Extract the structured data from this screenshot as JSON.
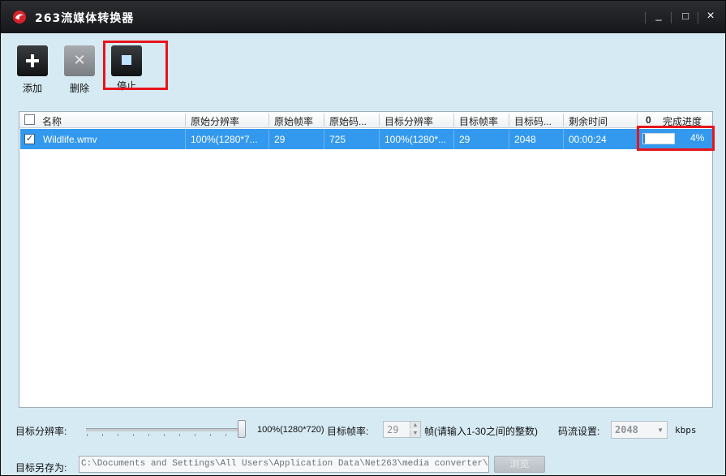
{
  "window": {
    "title": "263流媒体转换器",
    "controls": {
      "minimize": "_",
      "maximize": "□",
      "close": "×"
    }
  },
  "toolbar": {
    "add_label": "添加",
    "delete_label": "删除",
    "stop_label": "停止"
  },
  "table": {
    "headers": {
      "name": "名称",
      "src_resolution": "原始分辨率",
      "src_fps": "原始帧率",
      "src_bitrate": "原始码...",
      "dst_resolution": "目标分辨率",
      "dst_fps": "目标帧率",
      "dst_bitrate": "目标码...",
      "remaining": "剩余时间",
      "attach": "0",
      "progress": "完成进度"
    },
    "rows": [
      {
        "checked": true,
        "name": "Wildlife.wmv",
        "src_resolution": "100%(1280*7...",
        "src_fps": "29",
        "src_bitrate": "725",
        "dst_resolution": "100%(1280*...",
        "dst_fps": "29",
        "dst_bitrate": "2048",
        "remaining": "00:00:24",
        "progress_value": 0.04,
        "progress_text": "4%"
      }
    ]
  },
  "settings": {
    "resolution_label": "目标分辨率:",
    "resolution_value": "100%(1280*720)",
    "fps_label": "目标帧率:",
    "fps_value": "29",
    "fps_unit": "帧",
    "fps_hint": "(请输入1-30之间的整数)",
    "bitrate_label": "码流设置:",
    "bitrate_value": "2048",
    "bitrate_unit": "kbps",
    "save_as_label": "目标另存为:",
    "save_path": "C:\\Documents and Settings\\All Users\\Application Data\\Net263\\media converter\\users fi",
    "browse_label": "浏览"
  },
  "colors": {
    "titlebar": "#1e2023",
    "body_bg": "#d6eaf4",
    "selected_row": "#3399ee",
    "highlight_box": "#e8141c"
  }
}
